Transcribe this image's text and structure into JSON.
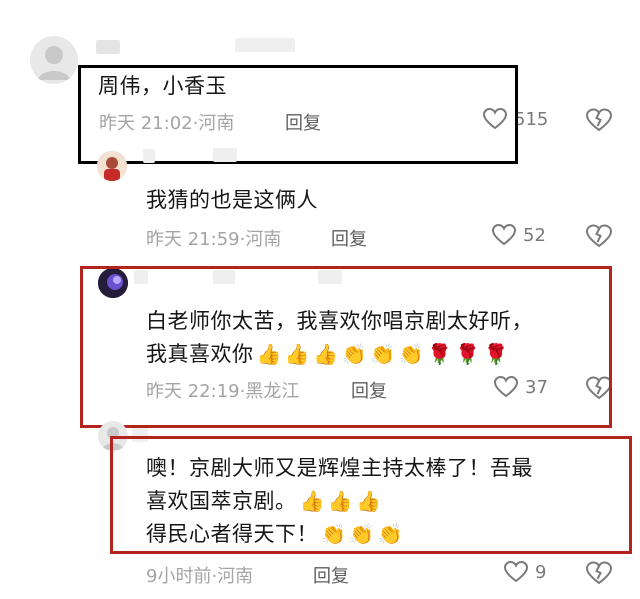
{
  "accent_colors": {
    "black_frame": "#000000",
    "red_frame": "#b5231f"
  },
  "comments": [
    {
      "text_lines": [
        "周伟，小香玉"
      ],
      "time": "昨天 21:02",
      "location": "河南",
      "reply_label": "回复",
      "likes": "515"
    },
    {
      "text_lines": [
        "我猜的也是这俩人"
      ],
      "time": "昨天 21:59",
      "location": "河南",
      "reply_label": "回复",
      "likes": "52"
    },
    {
      "text_lines": [
        "白老师你太苦，我喜欢你唱京剧太好听，",
        "我真喜欢你"
      ],
      "emojis_line2": [
        "👍",
        "👍",
        "👍",
        "👏",
        "👏",
        "👏",
        "🌹",
        "🌹",
        "🌹"
      ],
      "time": "昨天 22:19",
      "location": "黑龙江",
      "reply_label": "回复",
      "likes": "37"
    },
    {
      "text_lines": [
        "噢！京剧大师又是辉煌主持太棒了！吾最",
        "喜欢国萃京剧。",
        "得民心者得天下！"
      ],
      "emojis_line2": [
        "👍",
        "👍",
        "👍"
      ],
      "emojis_line3": [
        "👏",
        "👏",
        "👏"
      ],
      "time": "9小时前",
      "location": "河南",
      "reply_label": "回复",
      "likes": "9"
    }
  ],
  "icons": {
    "like": "heart-outline-icon",
    "dislike": "broken-heart-icon"
  }
}
